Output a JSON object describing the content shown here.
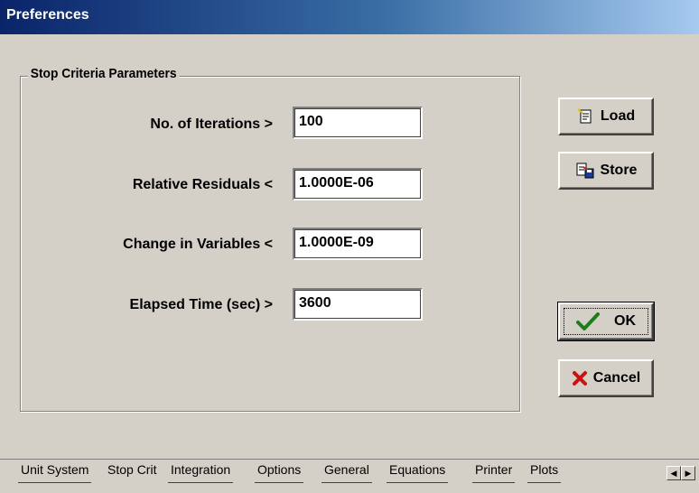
{
  "window": {
    "title": "Preferences"
  },
  "group": {
    "title": "Stop Criteria Parameters"
  },
  "params": [
    {
      "label": "No. of Iterations >",
      "value": "100"
    },
    {
      "label": "Relative Residuals <",
      "value": "1.0000E-06"
    },
    {
      "label": "Change in Variables <",
      "value": "1.0000E-09"
    },
    {
      "label": "Elapsed Time (sec) >",
      "value": "3600"
    }
  ],
  "buttons": {
    "load": {
      "label": "Load",
      "icon": "load-icon"
    },
    "store": {
      "label": "Store",
      "icon": "store-icon"
    },
    "ok": {
      "label": "OK",
      "icon": "check-icon"
    },
    "cancel": {
      "label": "Cancel",
      "icon": "x-icon"
    }
  },
  "tabs": [
    "Unit System",
    "Stop Crit",
    "Integration",
    "Options",
    "General",
    "Equations",
    "Printer",
    "Plots"
  ],
  "active_tab": "Stop Crit",
  "colors": {
    "check": "#1a7f1a",
    "cancel_x": "#cc1111",
    "title_start": "#0a246a",
    "title_end": "#a6caf0"
  }
}
